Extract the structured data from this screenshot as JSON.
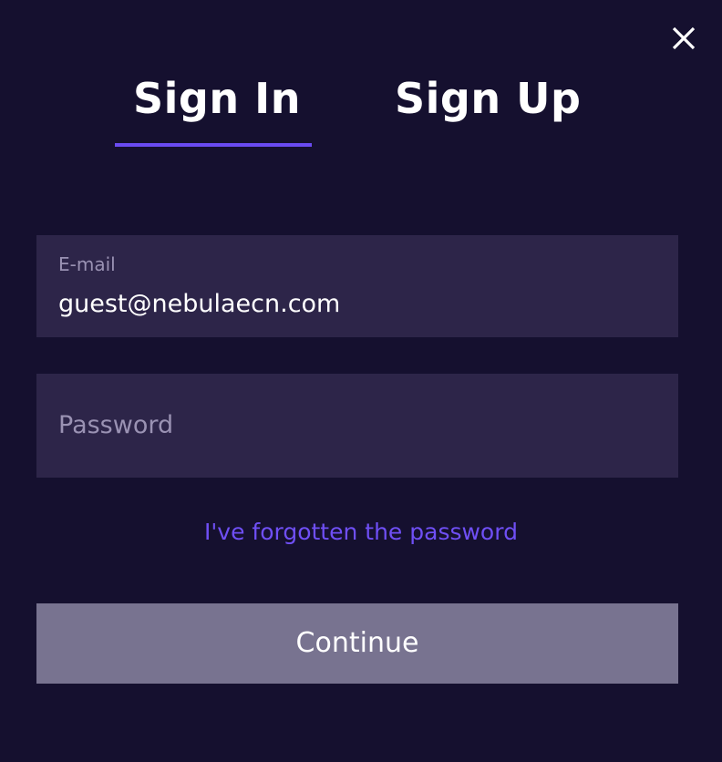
{
  "dialog": {
    "close_icon": "close-icon"
  },
  "tabs": [
    {
      "label": "Sign In",
      "active": true
    },
    {
      "label": "Sign Up",
      "active": false
    }
  ],
  "form": {
    "email": {
      "label": "E-mail",
      "value": "guest@nebulaecn.com"
    },
    "password": {
      "placeholder": "Password",
      "value": ""
    },
    "forgot_link": "I've forgotten the password",
    "submit_label": "Continue"
  },
  "colors": {
    "background": "#15102f",
    "field_background": "#2d2549",
    "accent": "#6a4bf2",
    "button_disabled": "#787390",
    "text_primary": "#ffffff",
    "text_muted": "#9a92b3"
  }
}
